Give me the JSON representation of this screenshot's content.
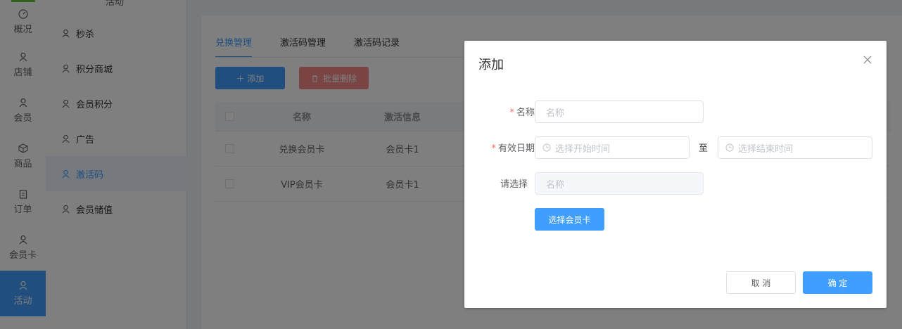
{
  "nav": {
    "items": [
      {
        "label": "概况",
        "icon": "dashboard-icon"
      },
      {
        "label": "店铺",
        "icon": "user-icon"
      },
      {
        "label": "会员",
        "icon": "user-icon"
      },
      {
        "label": "商品",
        "icon": "box-icon"
      },
      {
        "label": "订单",
        "icon": "clipboard-icon"
      },
      {
        "label": "会员卡",
        "icon": "user-icon"
      },
      {
        "label": "活动",
        "icon": "user-icon"
      }
    ]
  },
  "submenu": {
    "header": "活动",
    "items": [
      {
        "label": "秒杀"
      },
      {
        "label": "积分商城"
      },
      {
        "label": "会员积分"
      },
      {
        "label": "广告"
      },
      {
        "label": "激活码"
      },
      {
        "label": "会员储值"
      }
    ]
  },
  "tabs": [
    {
      "label": "兑换管理"
    },
    {
      "label": "激活码管理"
    },
    {
      "label": "激活码记录"
    }
  ],
  "toolbar": {
    "add_label": "＋ 添加",
    "batch_delete_label": "批量删除"
  },
  "table": {
    "headers": {
      "name": "名称",
      "info": "激活信息"
    },
    "rows": [
      {
        "name": "兑换会员卡",
        "info": "会员卡1"
      },
      {
        "name": "VIP会员卡",
        "info": "会员卡1"
      }
    ]
  },
  "dialog": {
    "title": "添加",
    "name_label": "名称",
    "name_placeholder": "名称",
    "date_label": "有效日期",
    "start_placeholder": "选择开始时间",
    "range_separator": "至",
    "end_placeholder": "选择结束时间",
    "select_label": "请选择",
    "select_placeholder": "名称",
    "pick_card_label": "选择会员卡",
    "cancel_label": "取 消",
    "confirm_label": "确 定",
    "required_mark": "*"
  },
  "colors": {
    "primary": "#409eff",
    "danger": "#f56c6c",
    "active_strip": "#67c23a"
  }
}
